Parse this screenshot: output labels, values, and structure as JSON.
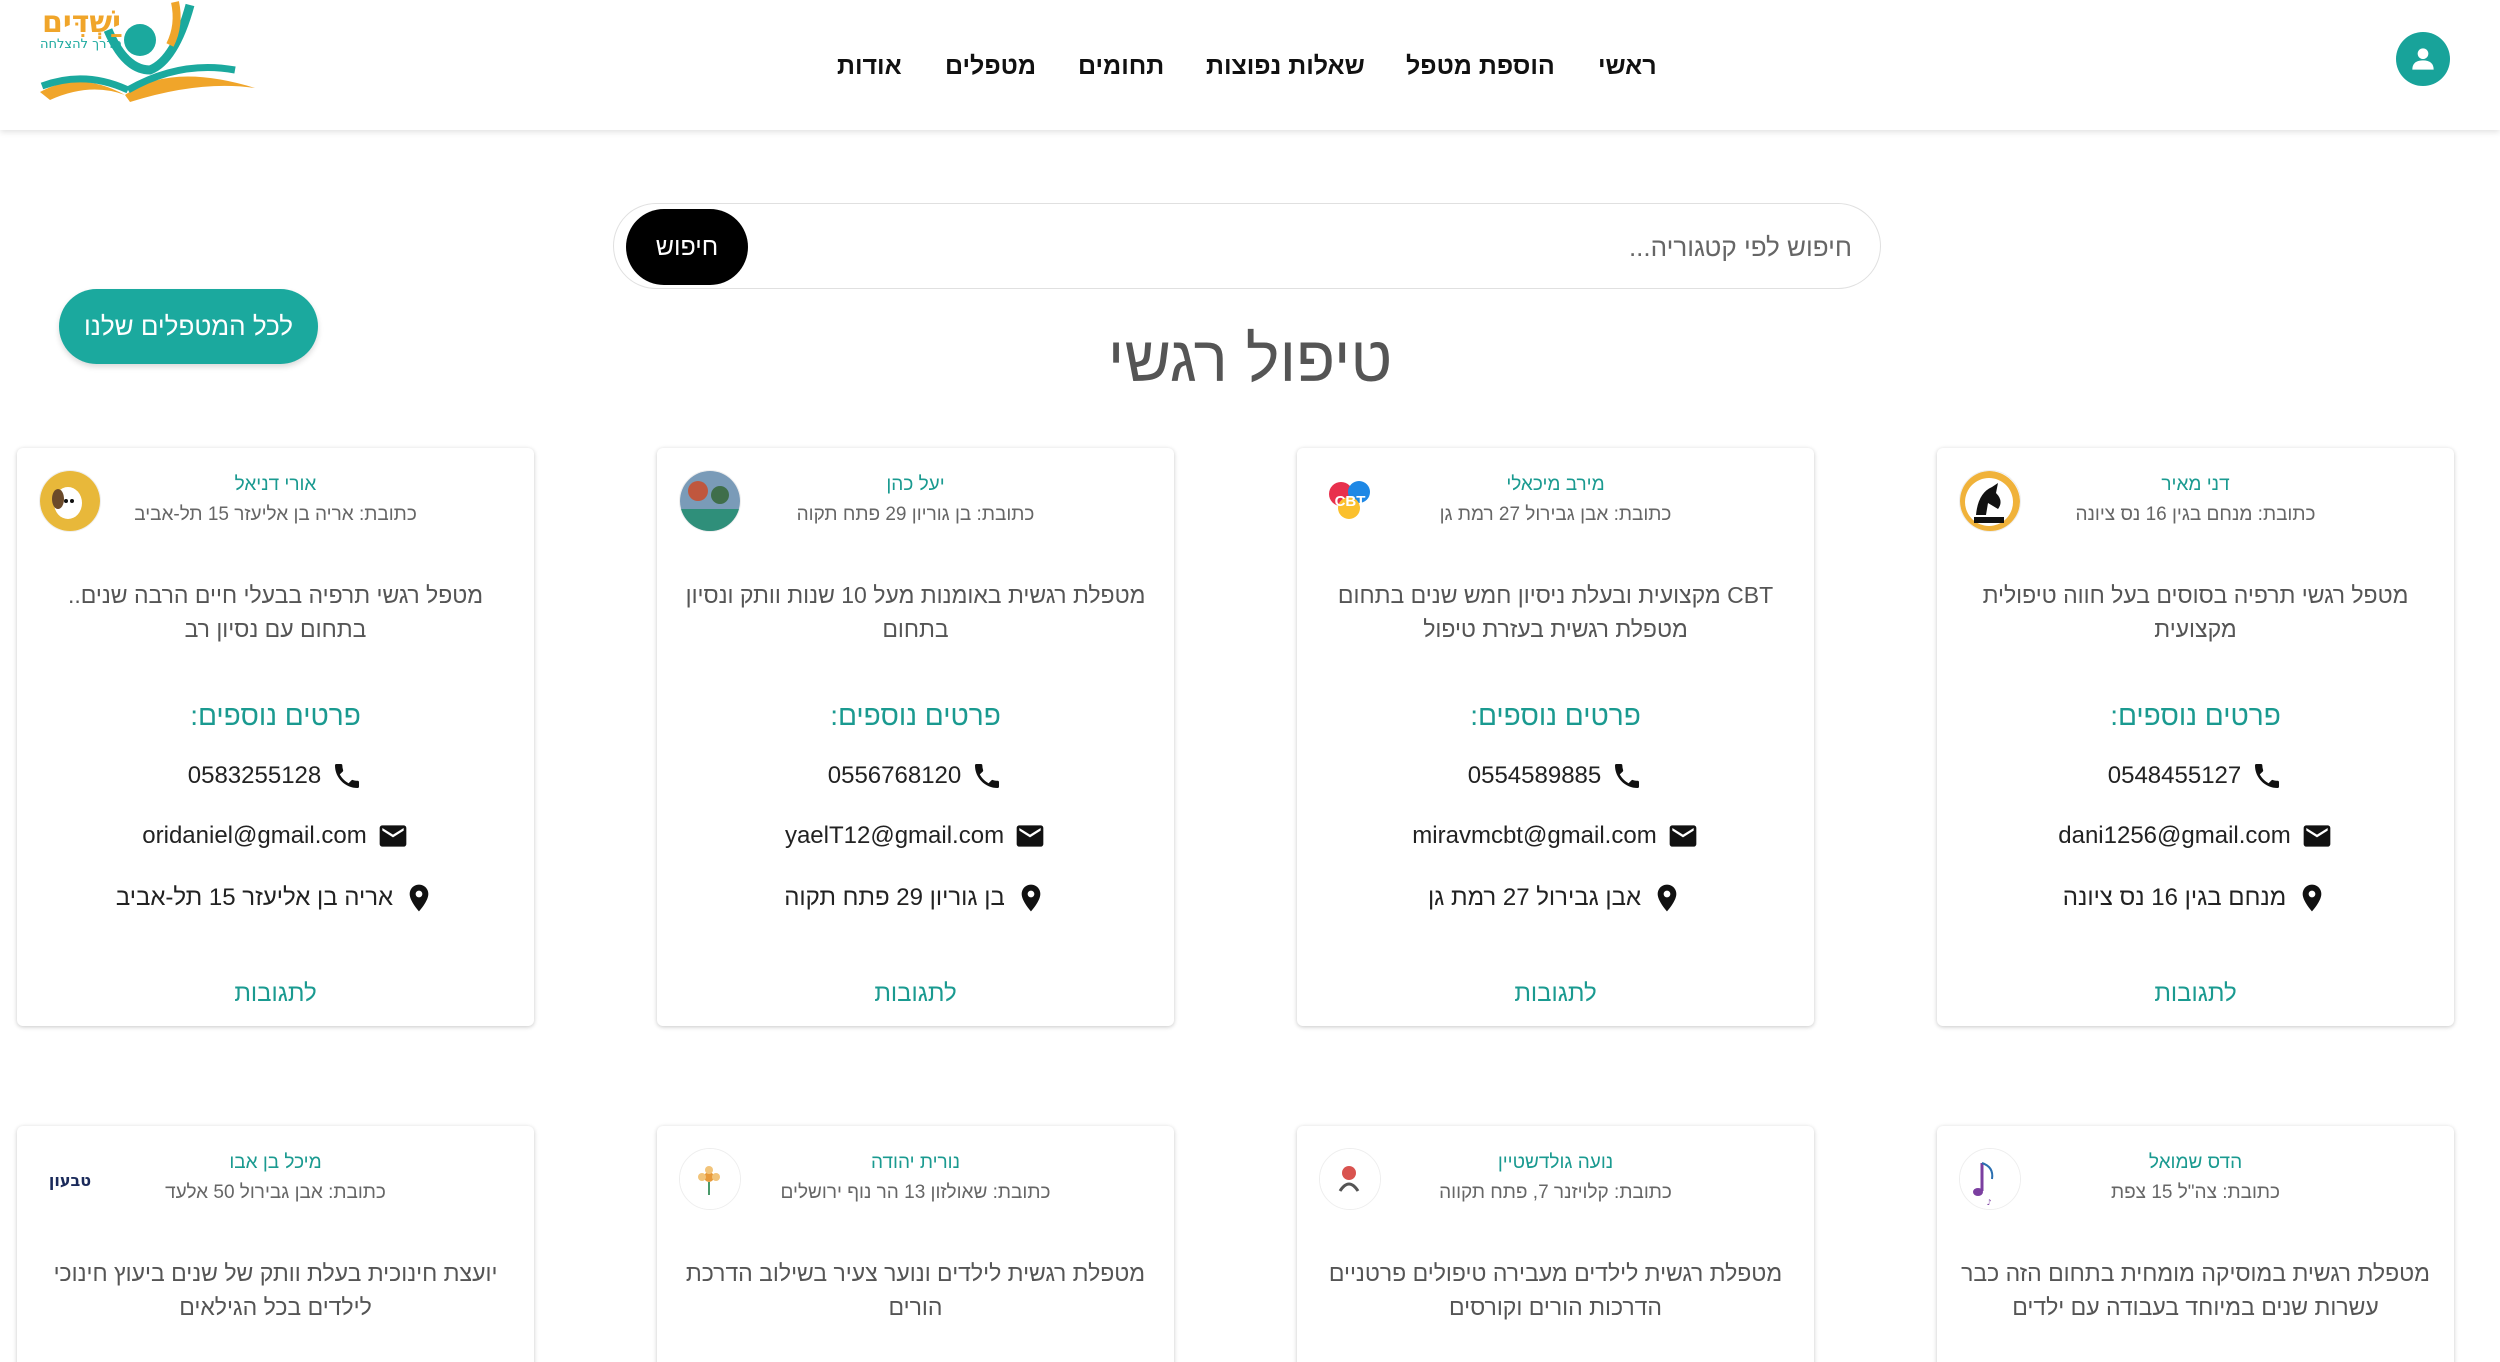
{
  "header": {
    "logo_text": "יַשְׁדִּים",
    "logo_sub": "הדרך להצלחה",
    "nav": [
      "ראשי",
      "הוספת מטפל",
      "שאלות נפוצות",
      "תחומים",
      "מטפלים",
      "אודות"
    ]
  },
  "search": {
    "placeholder": "חיפוש לפי קטגוריה...",
    "button": "חיפוש"
  },
  "all_therapists_button": "לכל המטפלים שלנו",
  "page_title": "טיפול רגשי",
  "colors": {
    "accent": "#1ba99e",
    "title": "#555555"
  },
  "cards": [
    {
      "name": "דני מאיר",
      "address_line": "כתובת: מנחם בגין 16 נס ציונה",
      "description": "מטפל רגשי תרפיה בסוסים בעל חווה טיפולית מקצועית",
      "more": "פרטים נוספים:",
      "phone": "0548455127",
      "email": "dani1256@gmail.com",
      "address": "מנחם בגין 16 נס ציונה",
      "link": "לתגובות",
      "avatar_icon": "horse-logo-icon"
    },
    {
      "name": "מירב מיכאלי",
      "address_line": "כתובת: אבן גבירול 27 רמת גן",
      "description": "CBT מקצועית ובעלת ניסיון חמש שנים בתחום מטפלת רגשית בעזרת טיפול",
      "more": "פרטים נוספים:",
      "phone": "0554589885",
      "email": "miravmcbt@gmail.com",
      "address": "אבן גבירול 27 רמת גן",
      "link": "לתגובות",
      "avatar_text": "CBT"
    },
    {
      "name": "יעל כהן",
      "address_line": "כתובת: בן גוריון 29 פתח תקוה",
      "description": "מטפלת רגשית באומנות מעל 10 שנות וותק ונסיון בתחום",
      "more": "פרטים נוספים:",
      "phone": "0556768120",
      "email": "yaelT12@gmail.com",
      "address": "בן גוריון 29 פתח תקוה",
      "link": "לתגובות",
      "avatar_icon": "art-photo-icon"
    },
    {
      "name": "אורי דניאל",
      "address_line": "כתובת: אריה בן אליעזר 15 תל-אביב",
      "description": "מטפל רגשי תרפיה בבעלי חיים הרבה שנים.. בתחום עם נסיון רב",
      "more": "פרטים נוספים:",
      "phone": "0583255128",
      "email": "oridaniel@gmail.com",
      "address": "אריה בן אליעזר 15 תל-אביב",
      "link": "לתגובות",
      "avatar_icon": "dog-photo-icon"
    },
    {
      "name": "הדס שמואל",
      "address_line": "כתובת: צה\"ל 15 צפת",
      "description": "מטפלת רגשית במוסיקה מומחית בתחום הזה כבר עשרות שנים במיוחד בעבודה עם ילדים",
      "avatar_icon": "music-logo-icon"
    },
    {
      "name": "נועה גולדשטיין",
      "address_line": "כתובת: קלויזנר 7, פתח תקווה",
      "description": "מטפלת רגשית לילדים מעבירה טיפולים פרטניים הדרכות הורים וקורסים",
      "avatar_icon": "child-logo-icon"
    },
    {
      "name": "נורית יהודה",
      "address_line": "כתובת: שאולזון 13 הר נוף ירושלים",
      "description": "מטפלת רגשית לילדים ונוער צעיר בשילוב הדרכת הורים",
      "avatar_icon": "flower-logo-icon"
    },
    {
      "name": "מיכל בן אבו",
      "address_line": "כתובת: אבן גבירול 50 אלעד",
      "description": "יועצת חינוכית בעלת וותק של שנים ביעוץ חינוכי לילדים בכל הגילאים",
      "avatar_text": "טבעון"
    }
  ]
}
